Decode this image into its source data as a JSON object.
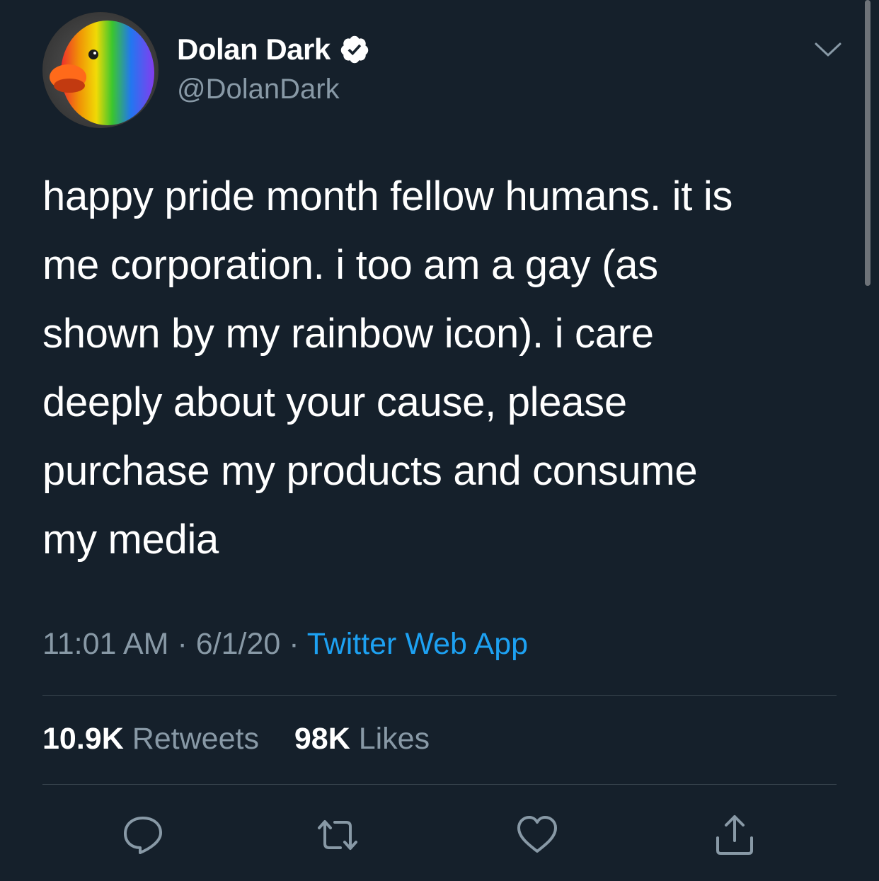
{
  "author": {
    "display_name": "Dolan Dark",
    "handle": "@DolanDark",
    "verified": true
  },
  "tweet": {
    "text_lines": [
      "happy pride month fellow humans. it is",
      "me corporation. i too am a gay (as",
      "shown by my rainbow icon). i care",
      "deeply about your cause, please",
      "purchase my products and consume",
      "my media"
    ],
    "time": "11:01 AM",
    "separator": "·",
    "date": "6/1/20",
    "source": "Twitter Web App"
  },
  "stats": {
    "retweets_count": "10.9K",
    "retweets_label": "Retweets",
    "likes_count": "98K",
    "likes_label": "Likes"
  },
  "icons": {
    "menu": "chevron-down-icon",
    "verified": "verified-badge-icon",
    "reply": "reply-icon",
    "retweet": "retweet-icon",
    "like": "heart-icon",
    "share": "share-icon"
  },
  "colors": {
    "background": "#15202b",
    "text_primary": "#ffffff",
    "text_secondary": "#8899a6",
    "link": "#1da1f2",
    "divider": "#38444d"
  }
}
